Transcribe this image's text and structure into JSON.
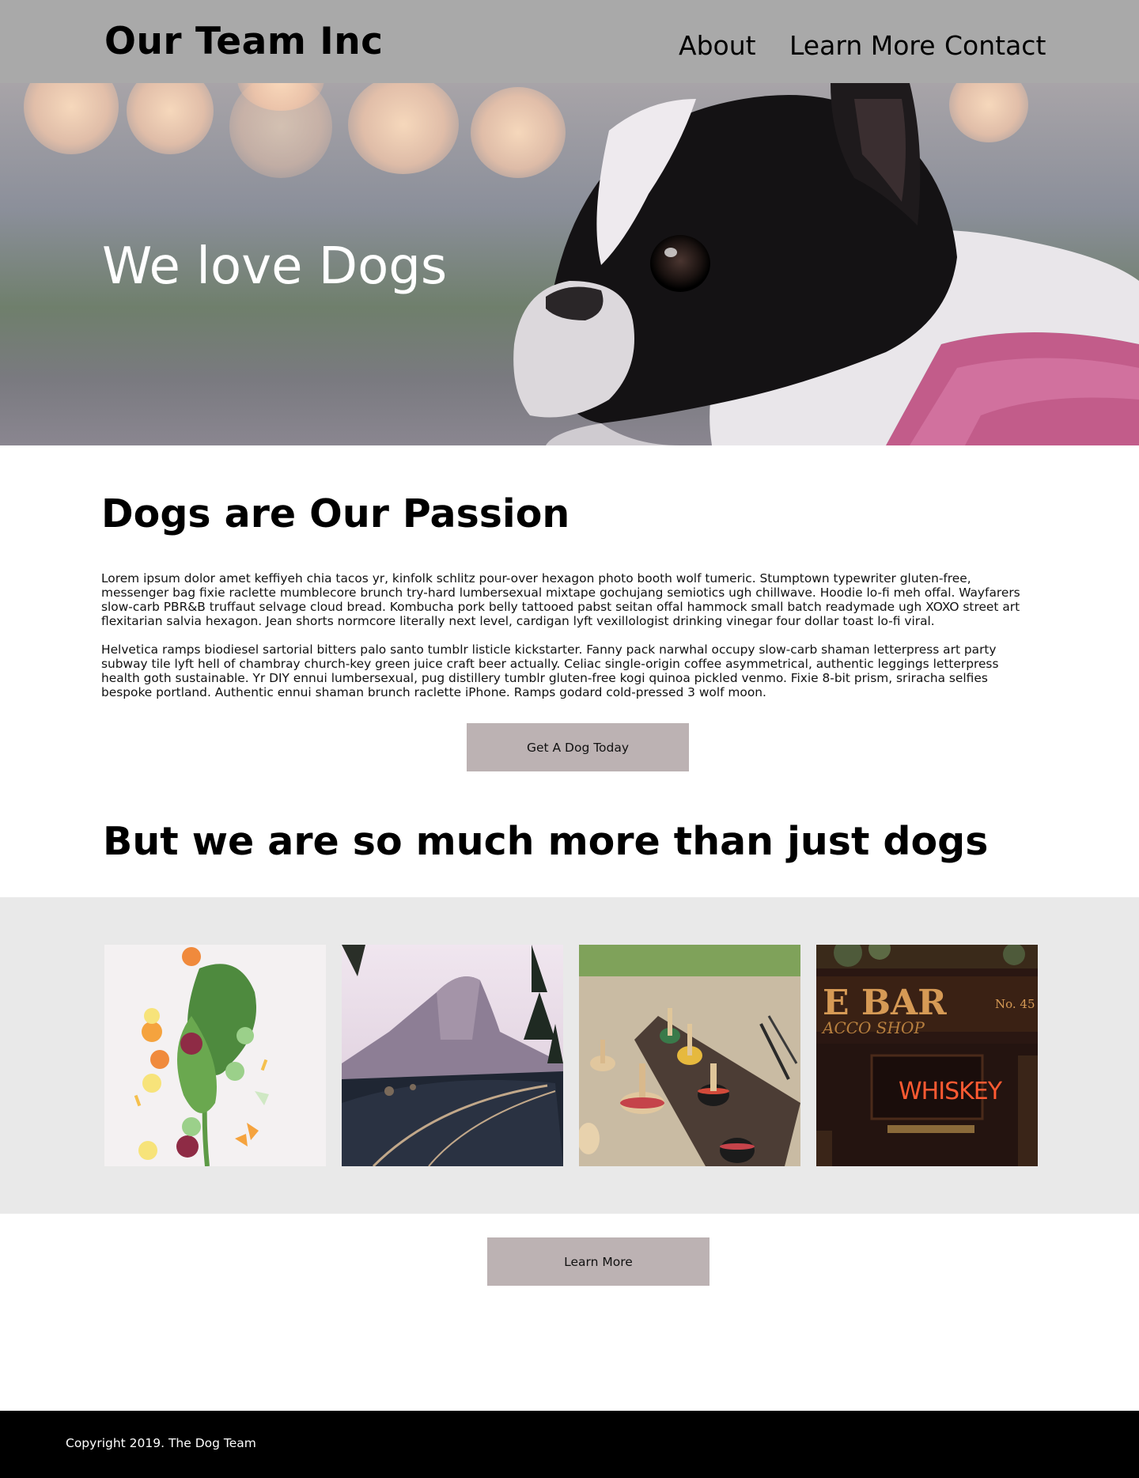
{
  "header": {
    "brand": "Our Team Inc",
    "nav": [
      {
        "label": "About"
      },
      {
        "label": "Learn More"
      },
      {
        "label": "Contact"
      }
    ]
  },
  "hero": {
    "title": "We love Dogs",
    "image": "boston-terrier-photo"
  },
  "passion": {
    "heading": "Dogs are Our Passion",
    "paragraphs": [
      "Lorem ipsum dolor amet keffiyeh chia tacos yr, kinfolk schlitz pour-over hexagon photo booth wolf tumeric. Stumptown typewriter gluten-free, messenger bag fixie raclette mumblecore brunch try-hard lumbersexual mixtape gochujang semiotics ugh chillwave. Hoodie lo-fi meh offal. Wayfarers slow-carb PBR&B truffaut selvage cloud bread. Kombucha pork belly tattooed pabst seitan offal hammock small batch readymade ugh XOXO street art flexitarian salvia hexagon. Jean shorts normcore literally next level, cardigan lyft vexillologist drinking vinegar four dollar toast lo-fi viral.",
      "Helvetica ramps biodiesel sartorial bitters palo santo tumblr listicle kickstarter. Fanny pack narwhal occupy slow-carb shaman letterpress art party subway tile lyft hell of chambray church-key green juice craft beer actually. Celiac single-origin coffee asymmetrical, authentic leggings letterpress health goth sustainable. Yr DIY ennui lumbersexual, pug distillery tumblr gluten-free kogi quinoa pickled venmo. Fixie 8-bit prism, sriracha selfies bespoke portland. Authentic ennui shaman brunch raclette iPhone. Ramps godard cold-pressed 3 wolf moon."
    ],
    "button_label": "Get A Dog Today"
  },
  "more": {
    "heading": "But we are so much more than just dogs",
    "gallery": [
      {
        "image": "vegetables-photo"
      },
      {
        "image": "mountain-road-photo"
      },
      {
        "image": "spinning-tops-photo"
      },
      {
        "image": "bar-sign-photo",
        "sign_top": "E BAR",
        "sign_no": "No. 45",
        "sign_sub": "ACCO SHOP",
        "neon": "WHISKEY"
      }
    ],
    "button_label": "Learn More"
  },
  "footer": {
    "copyright": "Copyright 2019. The Dog Team"
  },
  "colors": {
    "header_bg": "#a9a9a9",
    "button_bg": "#bcb2b3",
    "gallery_bg": "#e9e9e9",
    "footer_bg": "#000000"
  }
}
